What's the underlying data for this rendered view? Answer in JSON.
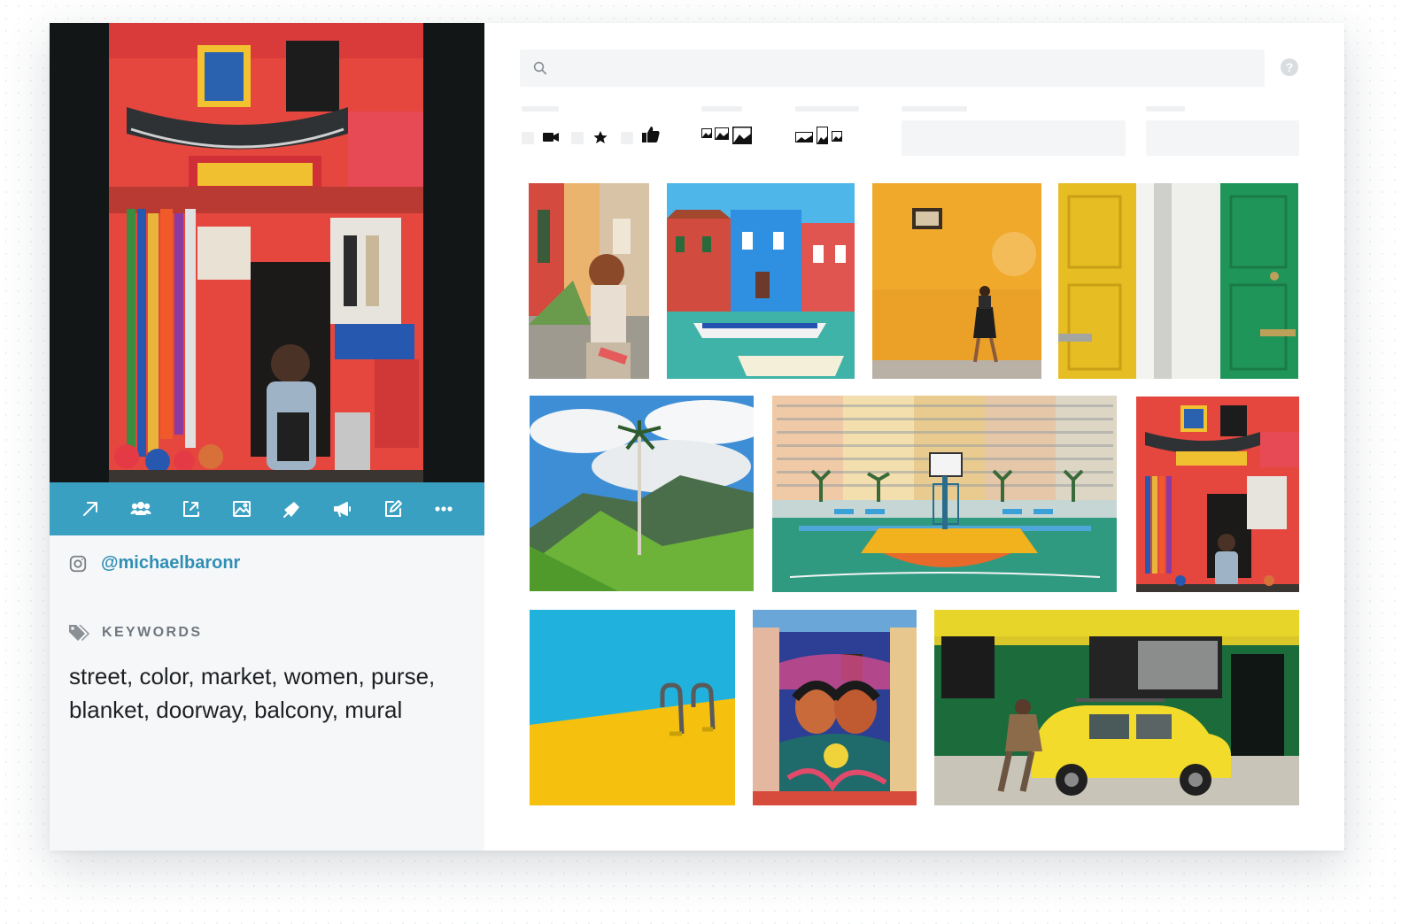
{
  "detail": {
    "instagram_handle": "@michaelbaronr",
    "keywords_label": "KEYWORDS",
    "keywords_text": "street, color, market, women, purse, blanket, doorway, balcony, mural"
  },
  "toolbar": {
    "actions": [
      "open-external",
      "people",
      "move-to",
      "image",
      "share",
      "announce",
      "edit",
      "more"
    ]
  },
  "search": {
    "value": "",
    "placeholder": ""
  },
  "help": {
    "label": "?"
  },
  "filters": {
    "type_icons": [
      "video-icon",
      "star-icon",
      "thumbs-up-icon"
    ],
    "size_icons": [
      "small-image-icon",
      "medium-image-icon",
      "large-image-icon"
    ],
    "orientation_icons": [
      "landscape-icon",
      "portrait-icon",
      "square-icon"
    ]
  },
  "gallery": {
    "tiles": [
      {
        "name": "photo-tile-alley-girl",
        "subject": "alley with colorful houses"
      },
      {
        "name": "photo-tile-venice-houses",
        "subject": "canal with colorful houses and boats"
      },
      {
        "name": "photo-tile-orange-wall",
        "subject": "woman walking by orange wall"
      },
      {
        "name": "photo-tile-doors",
        "subject": "yellow and green doors"
      },
      {
        "name": "photo-tile-palm-valley",
        "subject": "palm tree in green valley"
      },
      {
        "name": "photo-tile-basketball-court",
        "subject": "basketball court in front of apartments"
      },
      {
        "name": "photo-tile-market-shop",
        "subject": "colorful market shop"
      },
      {
        "name": "photo-tile-pool-ladder",
        "subject": "pool ladder on yellow and blue"
      },
      {
        "name": "photo-tile-mural",
        "subject": "street mural of two women"
      },
      {
        "name": "photo-tile-yellow-car",
        "subject": "yellow car with man on street"
      }
    ]
  },
  "colors": {
    "accent": "#3aa0c2",
    "link": "#2f8fb5",
    "panel_bg": "#f6f7f8",
    "preview_bg": "#121617"
  }
}
